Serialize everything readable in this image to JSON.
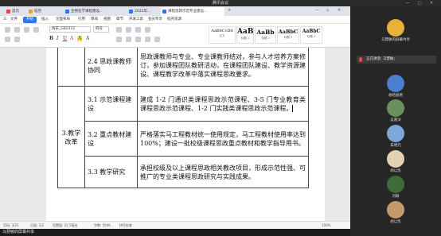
{
  "meeting": {
    "title": "腾讯会议",
    "footer_label": "马慧敏的屏幕共享",
    "speaking_label": "正在讲话: 马慧敏;",
    "participants": [
      {
        "name": "马慧敏的屏幕共享",
        "color": "#e8b23a"
      },
      {
        "name": "胡哈丽君",
        "color": "#4a7fd0"
      },
      {
        "name": "",
        "color": "#6b8f5a"
      },
      {
        "name": "吴嘉深",
        "color": "#7aa8d8"
      },
      {
        "name": "朱明元",
        "color": "#e0d2b0"
      },
      {
        "name": "",
        "color": "#3d6b3a"
      },
      {
        "name": "胡以凯",
        "color": "#c49a6c"
      },
      {
        "name": "刘颖",
        "color": "#5a5a5a"
      }
    ]
  },
  "wps": {
    "tabs": [
      {
        "label": "首页",
        "color": "#e04848"
      },
      {
        "label": "稻壳",
        "color": "#e0a43a"
      },
      {
        "label": "生物化学课程建设...",
        "color": "#2f74e8"
      },
      {
        "label": "2022年...",
        "color": "#2f74e8"
      },
      {
        "label": "课程思政示范专业建设...",
        "color": "#2f74e8"
      }
    ],
    "menu": [
      "三",
      "文件",
      "开始",
      "插入",
      "页面布局",
      "引用",
      "审阅",
      "视图",
      "章节",
      "开发工具",
      "会员专享",
      "稻壳资源"
    ],
    "font_name": "仿宋_GB2312",
    "font_size": "四号",
    "styles": [
      {
        "sample": "AaBbCcDd",
        "label": "正文"
      },
      {
        "sample": "AaB",
        "label": "标题 1"
      },
      {
        "sample": "AaBb",
        "label": "标题 2"
      },
      {
        "sample": "AaBbC",
        "label": "标题 3"
      },
      {
        "sample": "AaBbC",
        "label": "标题 4"
      }
    ],
    "status": {
      "page": "页码: 3/21",
      "pages": "页面: 1/2",
      "section": "设置值: 22.5毫米",
      "words": "字数: 5046",
      "spell": "拼写检查",
      "zoom": "100%"
    }
  },
  "document": {
    "row_top": {
      "label": "2.4 思政课教师协同",
      "text": "思政课教师与专业、专业课教师结对，参与人才培养方案修订，参加课程团队教研活动，在课程团队建设、教学资源建设、课程教学改革中落实课程思政要求。"
    },
    "category": "3.教学改革",
    "rows": [
      {
        "label": "3.1 示范课程建设",
        "text": "建成 1-2 门通识类课程思政示范课程、3-5 门专业教育类课程思政示范课程、1-2 门实践类课程思政示范课程。"
      },
      {
        "label": "3.2 重点教材建设",
        "text": "严格落实马工程教材统一使用规定，马工程教材使用率达到 100%；建设一批校级课程思政重点教材和教学指导用书。"
      },
      {
        "label": "3.3 教学研究",
        "text": "承担校级及以上课程思政相关教改项目，形成示范性强、可推广的专业类课程思政研究与实践成果。"
      }
    ]
  }
}
